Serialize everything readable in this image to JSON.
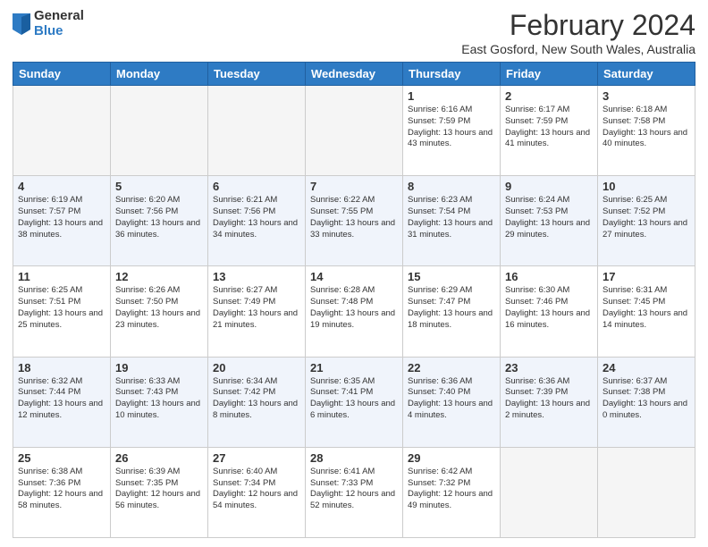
{
  "header": {
    "logo_general": "General",
    "logo_blue": "Blue",
    "month_title": "February 2024",
    "location": "East Gosford, New South Wales, Australia"
  },
  "days_of_week": [
    "Sunday",
    "Monday",
    "Tuesday",
    "Wednesday",
    "Thursday",
    "Friday",
    "Saturday"
  ],
  "weeks": [
    [
      {
        "num": "",
        "info": "",
        "empty": true
      },
      {
        "num": "",
        "info": "",
        "empty": true
      },
      {
        "num": "",
        "info": "",
        "empty": true
      },
      {
        "num": "",
        "info": "",
        "empty": true
      },
      {
        "num": "1",
        "info": "Sunrise: 6:16 AM\nSunset: 7:59 PM\nDaylight: 13 hours\nand 43 minutes."
      },
      {
        "num": "2",
        "info": "Sunrise: 6:17 AM\nSunset: 7:59 PM\nDaylight: 13 hours\nand 41 minutes."
      },
      {
        "num": "3",
        "info": "Sunrise: 6:18 AM\nSunset: 7:58 PM\nDaylight: 13 hours\nand 40 minutes."
      }
    ],
    [
      {
        "num": "4",
        "info": "Sunrise: 6:19 AM\nSunset: 7:57 PM\nDaylight: 13 hours\nand 38 minutes."
      },
      {
        "num": "5",
        "info": "Sunrise: 6:20 AM\nSunset: 7:56 PM\nDaylight: 13 hours\nand 36 minutes."
      },
      {
        "num": "6",
        "info": "Sunrise: 6:21 AM\nSunset: 7:56 PM\nDaylight: 13 hours\nand 34 minutes."
      },
      {
        "num": "7",
        "info": "Sunrise: 6:22 AM\nSunset: 7:55 PM\nDaylight: 13 hours\nand 33 minutes."
      },
      {
        "num": "8",
        "info": "Sunrise: 6:23 AM\nSunset: 7:54 PM\nDaylight: 13 hours\nand 31 minutes."
      },
      {
        "num": "9",
        "info": "Sunrise: 6:24 AM\nSunset: 7:53 PM\nDaylight: 13 hours\nand 29 minutes."
      },
      {
        "num": "10",
        "info": "Sunrise: 6:25 AM\nSunset: 7:52 PM\nDaylight: 13 hours\nand 27 minutes."
      }
    ],
    [
      {
        "num": "11",
        "info": "Sunrise: 6:25 AM\nSunset: 7:51 PM\nDaylight: 13 hours\nand 25 minutes."
      },
      {
        "num": "12",
        "info": "Sunrise: 6:26 AM\nSunset: 7:50 PM\nDaylight: 13 hours\nand 23 minutes."
      },
      {
        "num": "13",
        "info": "Sunrise: 6:27 AM\nSunset: 7:49 PM\nDaylight: 13 hours\nand 21 minutes."
      },
      {
        "num": "14",
        "info": "Sunrise: 6:28 AM\nSunset: 7:48 PM\nDaylight: 13 hours\nand 19 minutes."
      },
      {
        "num": "15",
        "info": "Sunrise: 6:29 AM\nSunset: 7:47 PM\nDaylight: 13 hours\nand 18 minutes."
      },
      {
        "num": "16",
        "info": "Sunrise: 6:30 AM\nSunset: 7:46 PM\nDaylight: 13 hours\nand 16 minutes."
      },
      {
        "num": "17",
        "info": "Sunrise: 6:31 AM\nSunset: 7:45 PM\nDaylight: 13 hours\nand 14 minutes."
      }
    ],
    [
      {
        "num": "18",
        "info": "Sunrise: 6:32 AM\nSunset: 7:44 PM\nDaylight: 13 hours\nand 12 minutes."
      },
      {
        "num": "19",
        "info": "Sunrise: 6:33 AM\nSunset: 7:43 PM\nDaylight: 13 hours\nand 10 minutes."
      },
      {
        "num": "20",
        "info": "Sunrise: 6:34 AM\nSunset: 7:42 PM\nDaylight: 13 hours\nand 8 minutes."
      },
      {
        "num": "21",
        "info": "Sunrise: 6:35 AM\nSunset: 7:41 PM\nDaylight: 13 hours\nand 6 minutes."
      },
      {
        "num": "22",
        "info": "Sunrise: 6:36 AM\nSunset: 7:40 PM\nDaylight: 13 hours\nand 4 minutes."
      },
      {
        "num": "23",
        "info": "Sunrise: 6:36 AM\nSunset: 7:39 PM\nDaylight: 13 hours\nand 2 minutes."
      },
      {
        "num": "24",
        "info": "Sunrise: 6:37 AM\nSunset: 7:38 PM\nDaylight: 13 hours\nand 0 minutes."
      }
    ],
    [
      {
        "num": "25",
        "info": "Sunrise: 6:38 AM\nSunset: 7:36 PM\nDaylight: 12 hours\nand 58 minutes."
      },
      {
        "num": "26",
        "info": "Sunrise: 6:39 AM\nSunset: 7:35 PM\nDaylight: 12 hours\nand 56 minutes."
      },
      {
        "num": "27",
        "info": "Sunrise: 6:40 AM\nSunset: 7:34 PM\nDaylight: 12 hours\nand 54 minutes."
      },
      {
        "num": "28",
        "info": "Sunrise: 6:41 AM\nSunset: 7:33 PM\nDaylight: 12 hours\nand 52 minutes."
      },
      {
        "num": "29",
        "info": "Sunrise: 6:42 AM\nSunset: 7:32 PM\nDaylight: 12 hours\nand 49 minutes."
      },
      {
        "num": "",
        "info": "",
        "empty": true
      },
      {
        "num": "",
        "info": "",
        "empty": true
      }
    ]
  ]
}
